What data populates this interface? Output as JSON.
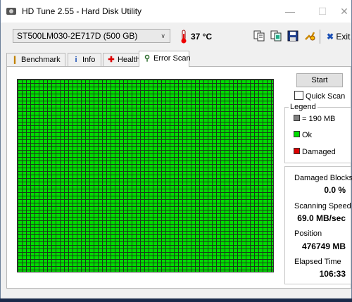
{
  "window": {
    "title": "HD Tune 2.55 - Hard Disk Utility",
    "controls": {
      "minimize": "—",
      "maximize": "☐",
      "close": "✕"
    }
  },
  "toolbar": {
    "drive": "ST500LM030-2E717D (500 GB)",
    "temperature": "37 °C",
    "exit_label": "Exit",
    "icons": [
      "copy-text-icon",
      "copy-image-icon",
      "save-icon",
      "options-icon",
      "exit-icon"
    ]
  },
  "tabs": [
    {
      "label": "Benchmark",
      "icon": "benchmark-icon",
      "active": false
    },
    {
      "label": "Info",
      "icon": "info-icon",
      "active": false
    },
    {
      "label": "Health",
      "icon": "health-icon",
      "active": false
    },
    {
      "label": "Error Scan",
      "icon": "magnifier-icon",
      "active": true
    }
  ],
  "scan": {
    "start_label": "Start",
    "quick_scan_label": "Quick Scan",
    "quick_scan_checked": false,
    "legend": {
      "title": "Legend",
      "items": [
        {
          "label": "= 190 MB",
          "color": "#808080"
        },
        {
          "label": "Ok",
          "color": "#00dd00"
        },
        {
          "label": "Damaged",
          "color": "#dd0000"
        }
      ]
    },
    "grid_color": "#00dd00",
    "stats": {
      "damaged_blocks_label": "Damaged Blocks",
      "damaged_blocks_value": "0.0 %",
      "scanning_speed_label": "Scanning Speed",
      "scanning_speed_value": "69.0 MB/sec",
      "position_label": "Position",
      "position_value": "476749 MB",
      "elapsed_time_label": "Elapsed Time",
      "elapsed_time_value": "106:33"
    }
  }
}
